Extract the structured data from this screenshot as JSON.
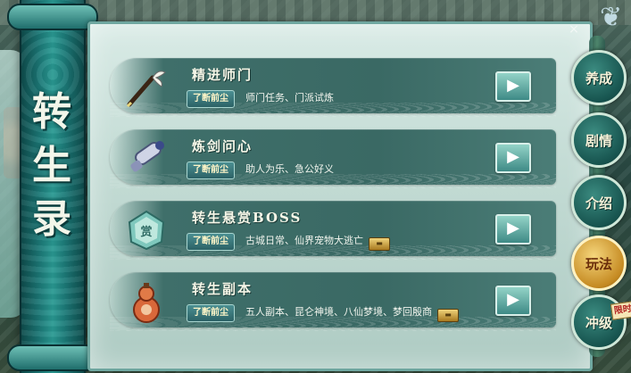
{
  "banner": {
    "title_chars": [
      "转",
      "生",
      "录"
    ]
  },
  "panel": {
    "close_glyph": "×",
    "rows": [
      {
        "name": "精进师门",
        "tag": "了断前尘",
        "desc": "师门任务、门派试炼",
        "locked": false,
        "icon": "brush-pen-icon",
        "go": "▶"
      },
      {
        "name": "炼剑问心",
        "tag": "了断前尘",
        "desc": "助人为乐、急公好义",
        "locked": false,
        "icon": "scroll-icon",
        "go": "▶"
      },
      {
        "name": "转生悬赏BOSS",
        "tag": "了断前尘",
        "desc": "古城日常、仙界宠物大逃亡",
        "locked": true,
        "icon": "bounty-token-icon",
        "go": "▶"
      },
      {
        "name": "转生副本",
        "tag": "了断前尘",
        "desc": "五人副本、昆仑神境、八仙梦境、梦回殷商",
        "locked": true,
        "icon": "gourd-icon",
        "go": "▶"
      }
    ]
  },
  "tabs": [
    {
      "label": "养成",
      "active": false
    },
    {
      "label": "剧情",
      "active": false
    },
    {
      "label": "介绍",
      "active": false
    },
    {
      "label": "玩法",
      "active": true
    },
    {
      "label": "冲级",
      "active": false,
      "badge": "限时"
    }
  ],
  "colors": {
    "panel_bg": "#c4dcd5",
    "row_bg": "#3f6f6a",
    "accent_gold": "#c58a22",
    "teal": "#1c7a78"
  }
}
